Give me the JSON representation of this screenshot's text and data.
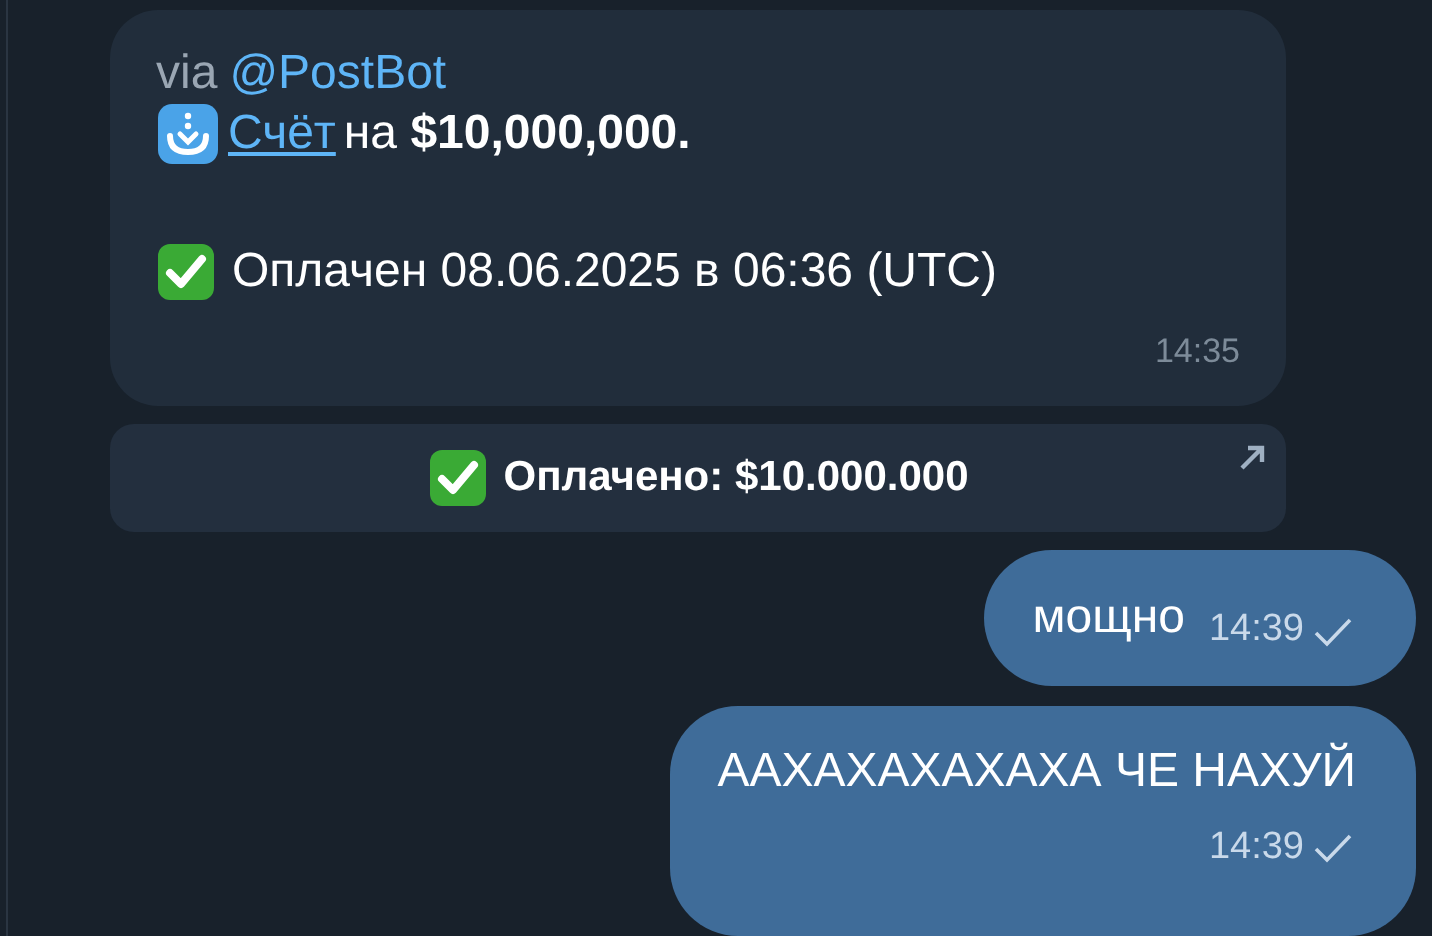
{
  "incoming": {
    "via": "via",
    "bot": "@PostBot",
    "link": "Счёт",
    "line_rest": "на **$10,000,000.**",
    "status": "Оплачен 08.06.2025 в 06:36 (UTC)",
    "time": "14:35"
  },
  "inline_button": {
    "label": "Оплачено: $10.000.000"
  },
  "outgoing": [
    {
      "text": "мощно",
      "time": "14:39",
      "read": false,
      "kind": "inline"
    },
    {
      "text": "ААХАХАХАХАХА ЧЕ НАХУЙ",
      "time": "14:39",
      "read": false,
      "kind": "stacked"
    }
  ]
}
